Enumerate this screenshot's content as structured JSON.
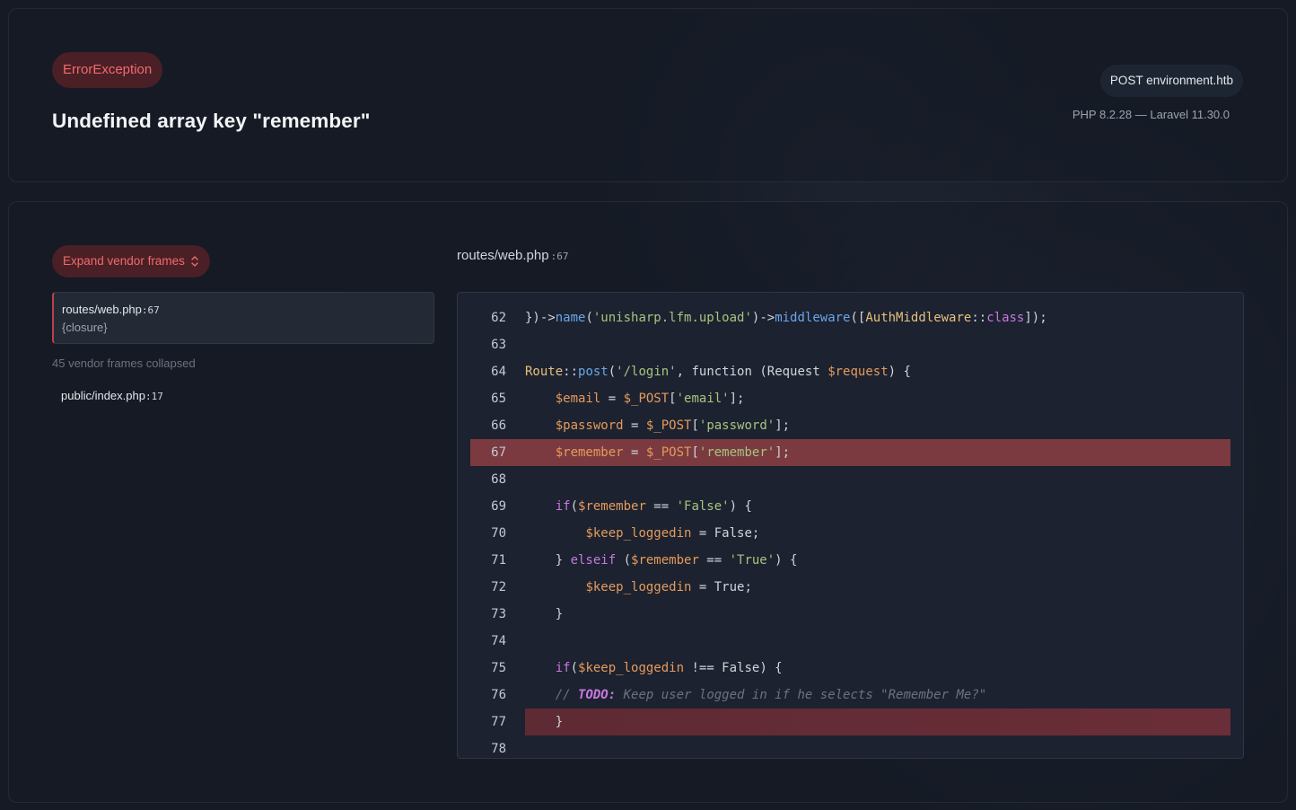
{
  "header": {
    "exception_class": "ErrorException",
    "message": "Undefined array key \"remember\"",
    "request": "POST environment.htb",
    "versions": "PHP 8.2.28 — Laravel 11.30.0"
  },
  "sidebar": {
    "vendor_button_label": "Expand vendor frames",
    "active_frame": {
      "file": "routes/web.php",
      "line": ":67",
      "sub": "{closure}"
    },
    "collapsed_text": "45 vendor frames collapsed",
    "frame2": {
      "file": "public/index.php",
      "line": ":17"
    }
  },
  "code_view": {
    "file": "routes/web.php",
    "line": ":67",
    "highlighted_line": 67,
    "lines": [
      {
        "n": "62",
        "text": "})->name('unisharp.lfm.upload')->middleware([AuthMiddleware::class]);"
      },
      {
        "n": "63",
        "text": ""
      },
      {
        "n": "64",
        "text": "Route::post('/login', function (Request $request) {"
      },
      {
        "n": "65",
        "text": "    $email = $_POST['email'];"
      },
      {
        "n": "66",
        "text": "    $password = $_POST['password'];"
      },
      {
        "n": "67",
        "text": "    $remember = $_POST['remember'];"
      },
      {
        "n": "68",
        "text": ""
      },
      {
        "n": "69",
        "text": "    if($remember == 'False') {"
      },
      {
        "n": "70",
        "text": "        $keep_loggedin = False;"
      },
      {
        "n": "71",
        "text": "    } elseif ($remember == 'True') {"
      },
      {
        "n": "72",
        "text": "        $keep_loggedin = True;"
      },
      {
        "n": "73",
        "text": "    }"
      },
      {
        "n": "74",
        "text": ""
      },
      {
        "n": "75",
        "text": "    if($keep_loggedin !== False) {"
      },
      {
        "n": "76",
        "text": "    // TODO: Keep user logged in if he selects \"Remember Me?\""
      },
      {
        "n": "77",
        "text": "    }"
      },
      {
        "n": "78",
        "text": ""
      }
    ]
  },
  "colors": {
    "accent_red": "#f26b6b",
    "badge_bg": "#4a1f26",
    "highlight_row": "#7a3a40"
  }
}
